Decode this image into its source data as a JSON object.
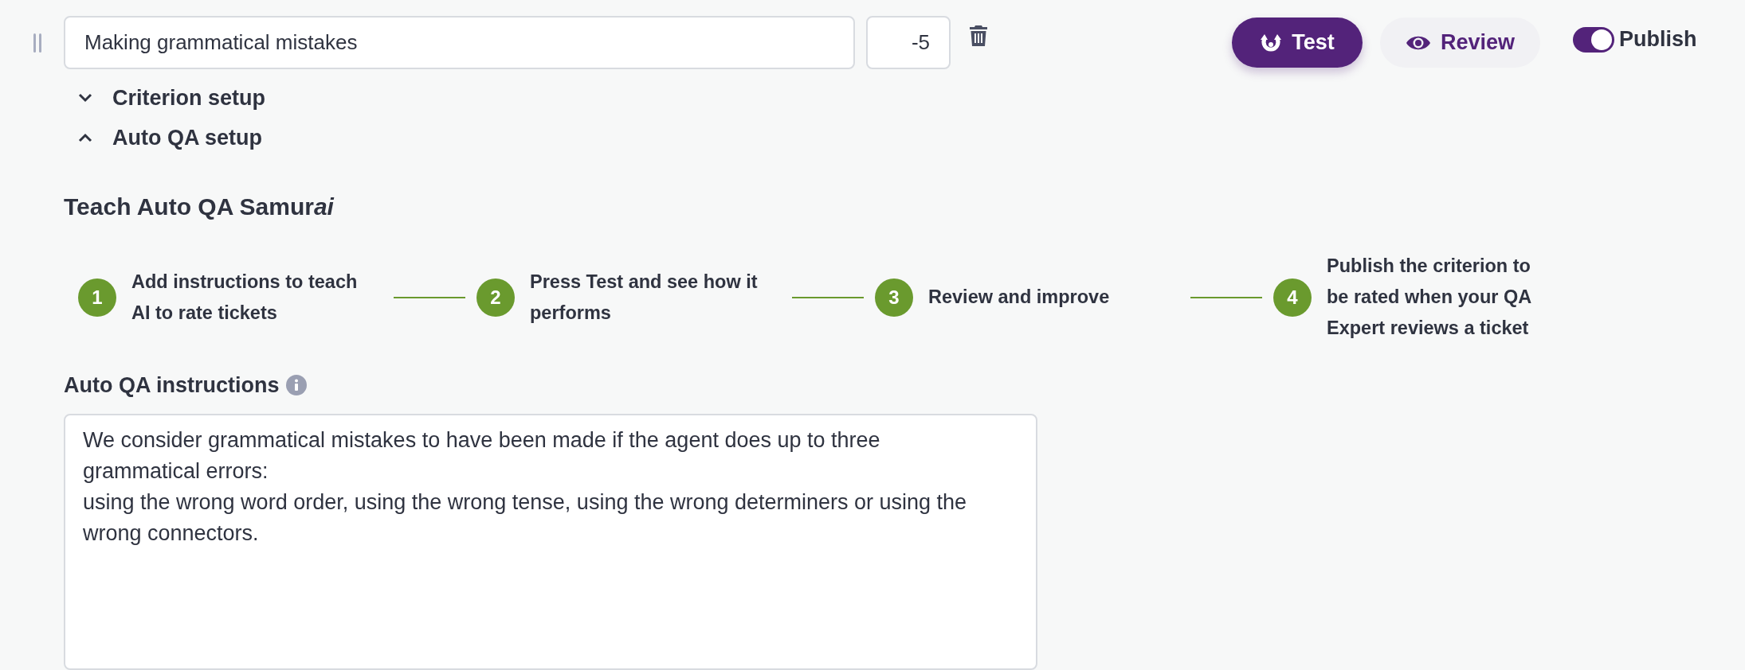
{
  "criterion": {
    "name": "Making grammatical mistakes",
    "score": "-5"
  },
  "actions": {
    "test": "Test",
    "review": "Review",
    "publish": {
      "label": "Publish",
      "on": true
    }
  },
  "sections": [
    {
      "label": "Criterion setup",
      "expanded": false
    },
    {
      "label": "Auto QA setup",
      "expanded": true
    }
  ],
  "teach_title": {
    "text": "Teach Auto QA Samur",
    "italic_part": "ai"
  },
  "steps": [
    {
      "number": "1",
      "text": "Add instructions to teach AI to rate tickets"
    },
    {
      "number": "2",
      "text": "Press Test and see how it performs"
    },
    {
      "number": "3",
      "text": "Review and improve"
    },
    {
      "number": "4",
      "text": "Publish the criterion to be rated when your QA Expert reviews a ticket"
    }
  ],
  "instructions": {
    "label": "Auto QA instructions",
    "value": "We consider grammatical mistakes to have been made if the agent does up to three grammatical errors:\nusing the wrong word order, using the wrong tense, using the wrong determiners or using the wrong connectors."
  }
}
